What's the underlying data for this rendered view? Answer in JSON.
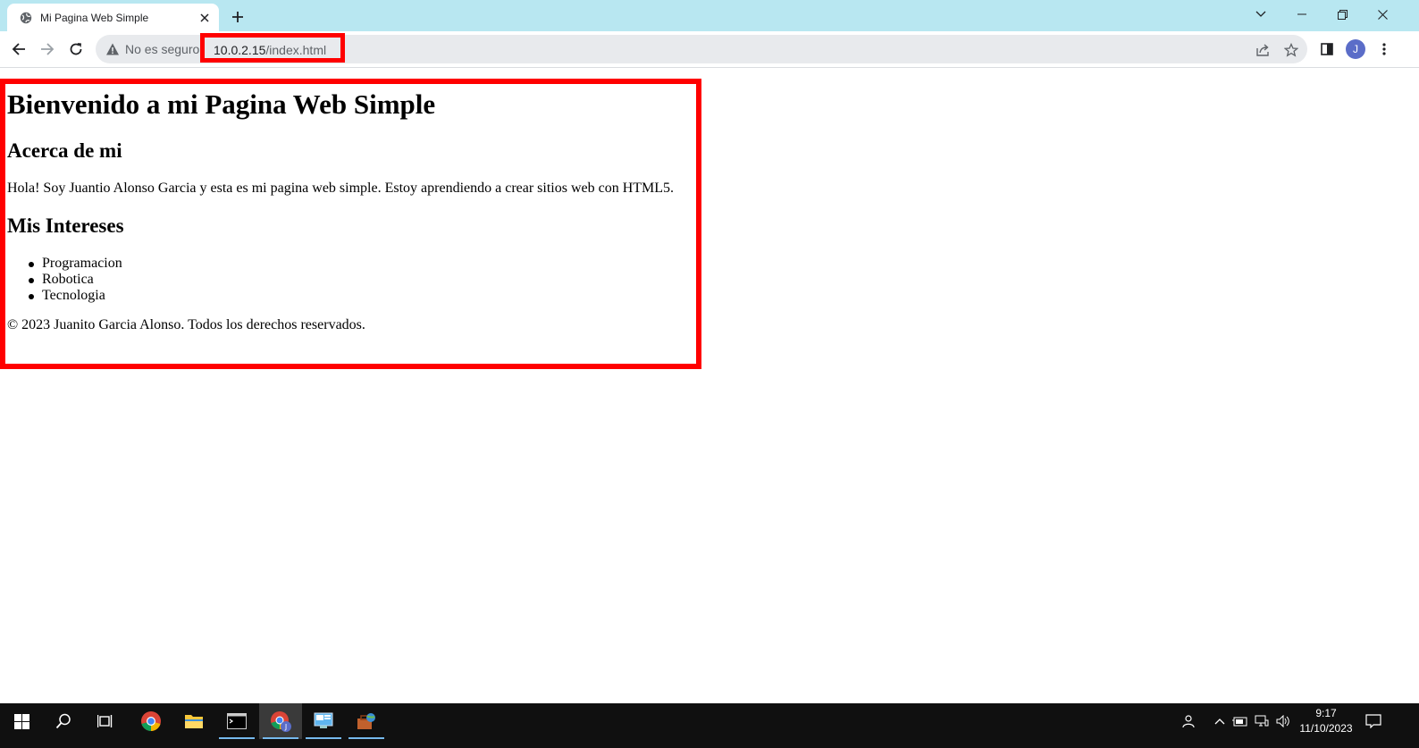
{
  "browser": {
    "tab": {
      "title": "Mi Pagina Web Simple"
    },
    "security_text": "No es seguro",
    "url": {
      "host": "10.0.2.15",
      "path": "/index.html"
    },
    "profile_initial": "J"
  },
  "page": {
    "heading": "Bienvenido a mi Pagina Web Simple",
    "about_heading": "Acerca de mi",
    "about_text": "Hola! Soy Juantio Alonso Garcia y esta es mi pagina web simple. Estoy aprendiendo a crear sitios web con HTML5.",
    "interests_heading": "Mis Intereses",
    "interests": [
      "Programacion",
      "Robotica",
      "Tecnologia"
    ],
    "footer": "© 2023 Juanito Garcia Alonso. Todos los derechos reservados."
  },
  "taskbar": {
    "time": "9:17",
    "date": "11/10/2023"
  },
  "colors": {
    "highlight": "#ff0000",
    "tabstrip": "#b8e7f1",
    "taskbar": "#101010"
  }
}
